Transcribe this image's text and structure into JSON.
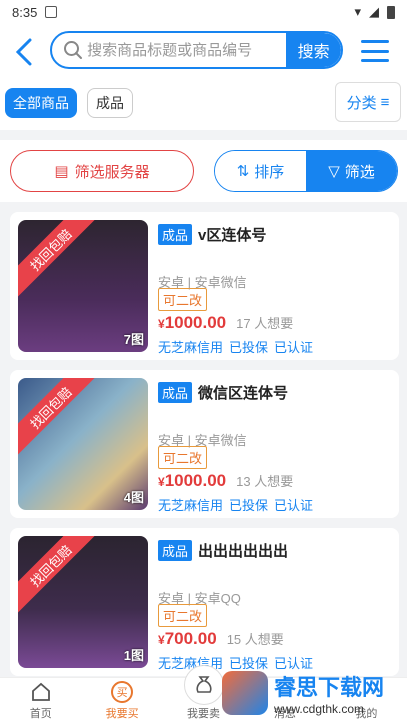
{
  "statusbar": {
    "time": "8:35"
  },
  "header": {
    "search_placeholder": "搜索商品标题或商品编号",
    "search_button": "搜索"
  },
  "filters": {
    "chips": [
      "全部商品",
      "成品"
    ],
    "sort_label": "分类"
  },
  "toolbar": {
    "server_button": "筛选服务器",
    "sort": "排序",
    "filter": "筛选"
  },
  "cards": [
    {
      "ribbon": "找回包赔",
      "image_count": "7图",
      "tag": "成品",
      "title": "v区连体号",
      "platform": "安卓",
      "channel": "安卓微信",
      "badge": "可二改",
      "price": "1000.00",
      "want": "17 人想要",
      "trust": [
        "无芝麻信用",
        "已投保",
        "已认证"
      ]
    },
    {
      "ribbon": "找回包赔",
      "image_count": "4图",
      "tag": "成品",
      "title": "微信区连体号",
      "platform": "安卓",
      "channel": "安卓微信",
      "badge": "可二改",
      "price": "1000.00",
      "want": "13 人想要",
      "trust": [
        "无芝麻信用",
        "已投保",
        "已认证"
      ]
    },
    {
      "ribbon": "找回包赔",
      "image_count": "1图",
      "tag": "成品",
      "title": "出出出出出出",
      "platform": "安卓",
      "channel": "安卓QQ",
      "badge": "可二改",
      "price": "700.00",
      "want": "15 人想要",
      "trust": [
        "无芝麻信用",
        "已投保",
        "已认证"
      ]
    }
  ],
  "currency": "¥",
  "tabbar": {
    "items": [
      "首页",
      "我要买",
      "我要卖",
      "消息",
      "我的"
    ]
  },
  "watermark": {
    "main": "睿思下载网",
    "sub": "www.cdgthk.com"
  },
  "colors": {
    "accent": "#1784f0",
    "danger": "#e24444",
    "price": "#e23b3b"
  }
}
